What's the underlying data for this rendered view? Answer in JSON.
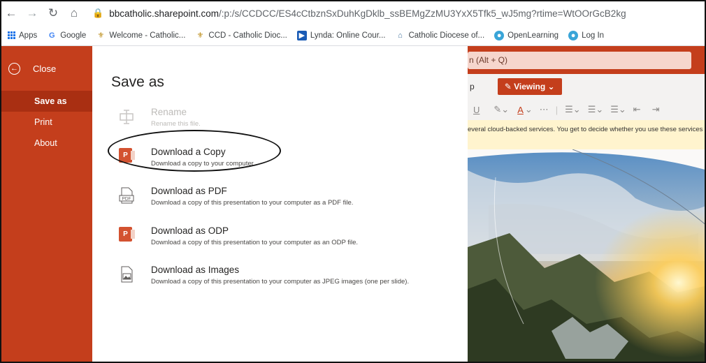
{
  "browser": {
    "url_host": "bbcatholic.sharepoint.com",
    "url_path": "/:p:/s/CCDCC/ES4cCtbznSxDuhKgDklb_ssBEMgZzMU3YxX5Tfk5_wJ5mg?rtime=WtOOrGcB2kg",
    "bookmarks": [
      {
        "label": "Apps",
        "icon": "apps-grid-icon"
      },
      {
        "label": "Google",
        "icon": "google-icon"
      },
      {
        "label": "Welcome - Catholic...",
        "icon": "fleur-de-lis-icon"
      },
      {
        "label": "CCD - Catholic Dioc...",
        "icon": "fleur-de-lis-icon"
      },
      {
        "label": "Lynda: Online Cour...",
        "icon": "lynda-icon"
      },
      {
        "label": "Catholic Diocese of...",
        "icon": "church-icon"
      },
      {
        "label": "OpenLearning",
        "icon": "openlearning-icon"
      },
      {
        "label": "Log In",
        "icon": "openlearning-icon"
      }
    ]
  },
  "sidebar": {
    "close_label": "Close",
    "items": [
      {
        "label": "Save as",
        "active": true
      },
      {
        "label": "Print",
        "active": false
      },
      {
        "label": "About",
        "active": false
      }
    ]
  },
  "panel": {
    "title": "Save as",
    "options": [
      {
        "title": "Rename",
        "desc": "Rename this file.",
        "disabled": true,
        "icon": "rename-icon"
      },
      {
        "title": "Download a Copy",
        "desc": "Download a copy to your computer.",
        "disabled": false,
        "icon": "powerpoint-icon"
      },
      {
        "title": "Download as PDF",
        "desc": "Download a copy of this presentation to your computer as a PDF file.",
        "disabled": false,
        "icon": "pdf-icon"
      },
      {
        "title": "Download as ODP",
        "desc": "Download a copy of this presentation to your computer as an ODP file.",
        "disabled": false,
        "icon": "powerpoint-icon"
      },
      {
        "title": "Download as Images",
        "desc": "Download a copy of this presentation to your computer as JPEG images (one per slide).",
        "disabled": false,
        "icon": "image-icon"
      }
    ]
  },
  "editor": {
    "search_text": "n (Alt + Q)",
    "ribbon_tab_fragment": "p",
    "viewing_label": "Viewing",
    "notice_text": "everal cloud-backed services. You get to decide whether you use these services"
  },
  "colors": {
    "accent": "#c43e1c",
    "accent_dark": "#a92f12"
  }
}
